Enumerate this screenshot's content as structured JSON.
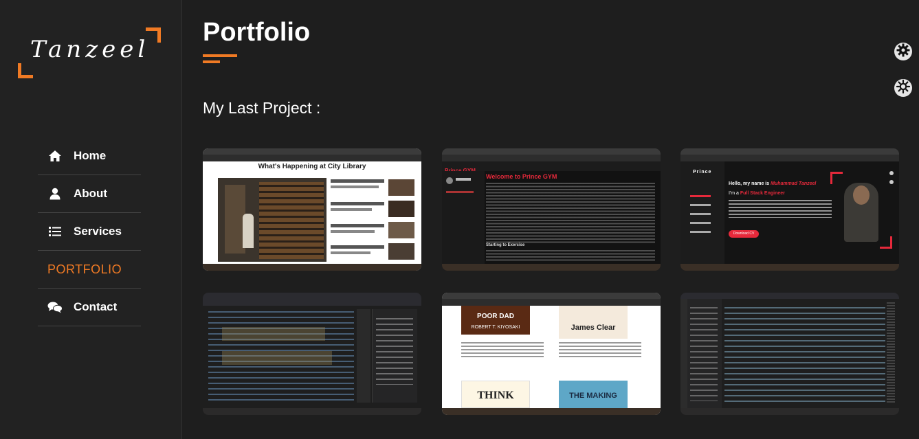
{
  "brand": {
    "logo_text": "Tanzeel",
    "accent": "#f07a24"
  },
  "nav": {
    "items": [
      {
        "label": "Home",
        "icon": "home-icon"
      },
      {
        "label": "About",
        "icon": "user-icon"
      },
      {
        "label": "Services",
        "icon": "list-icon"
      },
      {
        "label": "PORTFOLIO",
        "icon": ""
      },
      {
        "label": "Contact",
        "icon": "chat-bubbles-icon"
      }
    ],
    "active": "PORTFOLIO"
  },
  "page": {
    "title": "Portfolio",
    "section_title": "My Last Project :"
  },
  "projects": [
    {
      "name": "library",
      "heading": "What's Happening at City Library"
    },
    {
      "name": "gym",
      "brand": "Prince GYM",
      "heading": "Welcome to Prince GYM",
      "subheading": "Starting to Exercise"
    },
    {
      "name": "prince-portfolio",
      "brand": "Prince",
      "greeting": "Hello, my name is",
      "name_text": "Muhammad Tanzeel",
      "role_prefix": "I'm a",
      "role": "Full Stack Engineer",
      "button": "Download CV"
    },
    {
      "name": "code-editor-1"
    },
    {
      "name": "books",
      "book1": "POOR DAD",
      "book1_author": "ROBERT T. KIYOSAKI",
      "book2": "James Clear",
      "book3": "THINK",
      "book4": "THE MAKING"
    },
    {
      "name": "code-editor-2"
    }
  ],
  "tools": [
    {
      "icon": "gear-icon"
    },
    {
      "icon": "sun-icon"
    }
  ]
}
